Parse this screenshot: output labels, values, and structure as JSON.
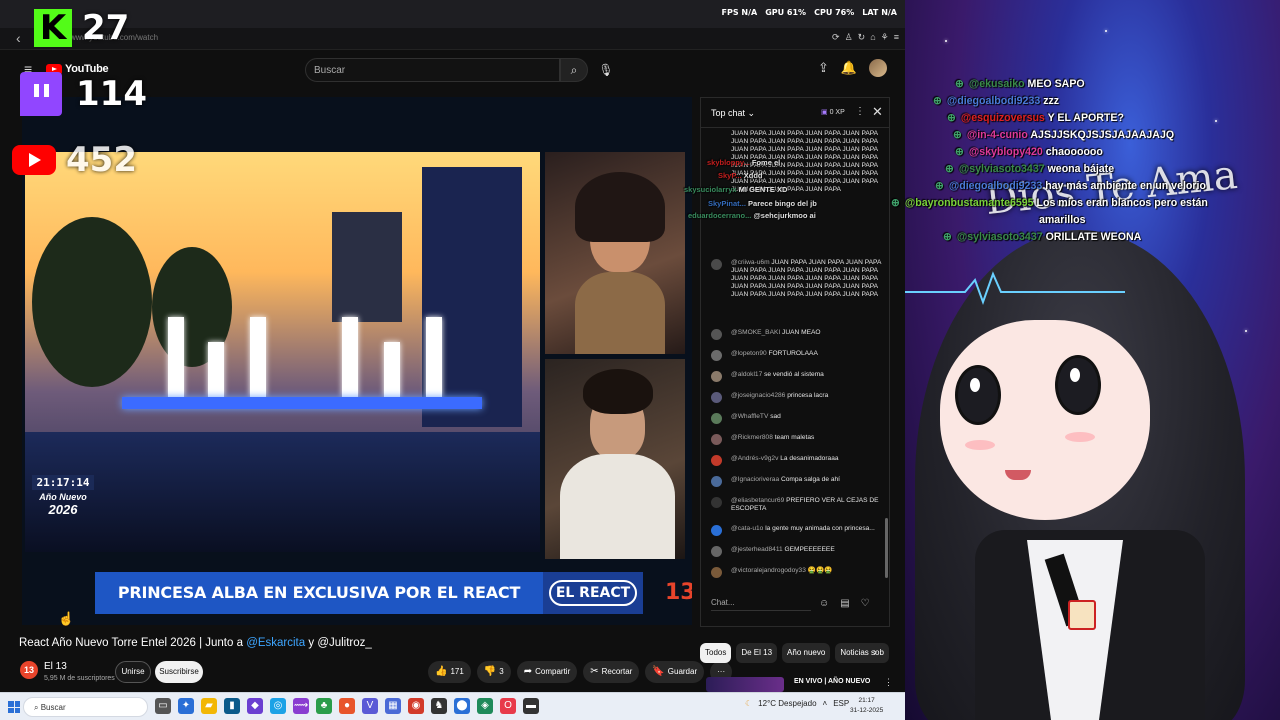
{
  "system_stats": {
    "fps_label": "FPS",
    "fps": "N/A",
    "gpu_label": "GPU",
    "gpu": "61%",
    "cpu_label": "CPU",
    "cpu": "76%",
    "lat_label": "LAT",
    "lat": "N/A"
  },
  "browser": {
    "url": "www.youtube.com/watch"
  },
  "viewer_overlay": {
    "kick": {
      "badge": "K",
      "count": "27"
    },
    "twitch": {
      "count": "114"
    },
    "youtube": {
      "count": "452"
    }
  },
  "youtube": {
    "logo_text": "YouTube",
    "search_placeholder": "Buscar",
    "video": {
      "clock_time": "21:17:14",
      "clock_line1": "Año Nuevo",
      "clock_year": "2026",
      "banner": "PRINCESA ALBA EN EXCLUSIVA POR EL REACT",
      "banner_tag": "EL REACT",
      "channel_bug": "13",
      "title_prefix": "React Año Nuevo Torre Entel 2026 | Junto a",
      "mention1": "@Eskarcita",
      "title_mid": "y",
      "mention2": "@Julitroz_"
    },
    "channel": {
      "avatar": "13",
      "name": "El 13",
      "subscribers": "5,95 M de suscriptores",
      "join": "Unirse",
      "subscribe": "Suscribirse"
    },
    "actions": {
      "likes": "171",
      "dislikes": "3",
      "share": "Compartir",
      "clip": "Recortar",
      "save": "Guardar",
      "more": "···"
    },
    "chat": {
      "title": "Top chat",
      "xp": "0 XP",
      "input_placeholder": "Chat...",
      "messages": [
        {
          "user": "",
          "text": "JUAN PAPA JUAN PAPA JUAN PAPA JUAN PAPA JUAN PAPA JUAN PAPA JUAN PAPA JUAN PAPA JUAN PAPA JUAN PAPA JUAN PAPA JUAN PAPA JUAN PAPA JUAN PAPA JUAN PAPA JUAN PAPA JUAN PAPA JUAN PAPA JUAN PAPA JUAN PAPA JUAN PAPA JUAN PAPA JUAN PAPA JUAN PAPA JUAN PAPA JUAN PAPA JUAN PAPA JUAN PAPA JUAN PAPA JUAN PAPA JUAN PAPA"
        },
        {
          "user": "@criiwa-u6m",
          "text": "JUAN PAPA JUAN PAPA JUAN PAPA JUAN PAPA JUAN PAPA JUAN PAPA JUAN PAPA JUAN PAPA JUAN PAPA JUAN PAPA JUAN PAPA JUAN PAPA JUAN PAPA JUAN PAPA JUAN PAPA JUAN PAPA JUAN PAPA JUAN PAPA JUAN PAPA"
        },
        {
          "user": "@SMOKE_BAKI",
          "text": "JUAN MEAO"
        },
        {
          "user": "@lopeton90",
          "text": "FORTUROLAAA"
        },
        {
          "user": "@aldokl17",
          "text": "se vendió al sistema"
        },
        {
          "user": "@joseignacio4286",
          "text": "princesa lacra"
        },
        {
          "user": "@WhaffleTV",
          "text": "sad"
        },
        {
          "user": "@Rickmer808",
          "text": "team maletas"
        },
        {
          "user": "@Andrés-v9g2v",
          "text": "La desanimadoraaa"
        },
        {
          "user": "@Ignacioriveraa",
          "text": "Compa salga de ahí"
        },
        {
          "user": "@eliasbetancur69",
          "text": "PREFIERO VER AL CEJAS DE ESCOPETA"
        },
        {
          "user": "@cata-u1o",
          "text": "la gente muy animada con princesa..."
        },
        {
          "user": "@jesterhead8411",
          "text": "GEMPEEEEEEE"
        },
        {
          "user": "@victoralejandrogodoy33",
          "text": "🤮🤮🤮"
        }
      ]
    },
    "chips": [
      "Todos",
      "De El 13",
      "Año nuevo",
      "Noticias sob"
    ],
    "related": {
      "title": "EN VIVO | AÑO NUEVO"
    }
  },
  "taskbar": {
    "search": "Buscar",
    "weather": "12°C Despejado",
    "lang": "ESP",
    "time": "21:17",
    "date": "31-12-2025"
  },
  "stream": {
    "sign_text": "Dios Te Ama",
    "chat": [
      {
        "user": "@ekusaiko",
        "text": "MEO SAPO",
        "user_color": "#3a8a4a"
      },
      {
        "user": "@diegoalbodi9233",
        "text": "zzz",
        "user_color": "#4a7bd8"
      },
      {
        "user": "@esquizoversus",
        "text": "Y EL APORTE?",
        "user_color": "#e02020"
      },
      {
        "user": "@in-4-cunio",
        "text": "AJSJJSKQJSJSJAJAAJAJQ",
        "user_color": "#e03a9a"
      },
      {
        "user": "@skyblopy420",
        "text": "chaoooooo",
        "user_color": "#e03a9a"
      },
      {
        "user": "@sylviasoto3437",
        "text": "weona bájate",
        "user_color": "#3a8a4a"
      },
      {
        "user": "@diegoalbodi9233",
        "text": "hay más ambiente en un velorio",
        "user_color": "#4a7bd8"
      },
      {
        "user": "@bayronbustamante6595",
        "text": "Los míos eran blancos pero están",
        "user_color": "#7ad23a"
      },
      {
        "user": "",
        "text": "amarillos",
        "user_color": "#7ad23a"
      },
      {
        "user": "@sylviasoto3437",
        "text": "ORILLATE WEONA",
        "user_color": "#3a8a4a"
      }
    ],
    "chat_ghost": [
      {
        "user": "skybloppy...",
        "text": "Fome el",
        "user_color": "#e02020"
      },
      {
        "user": "SkyP...",
        "text": "Xddd",
        "user_color": "#e02020"
      },
      {
        "user": "skysuciolarryx",
        "text": "MI GENTE XD",
        "user_color": "#3fa06a"
      },
      {
        "user": "SkyPinat...",
        "text": "Parece bingo del jb",
        "user_color": "#3a7bd8"
      },
      {
        "user": "eduardocerrano...",
        "text": "@sehcjurkmoo ai",
        "user_color": "#3fa06a"
      }
    ]
  }
}
